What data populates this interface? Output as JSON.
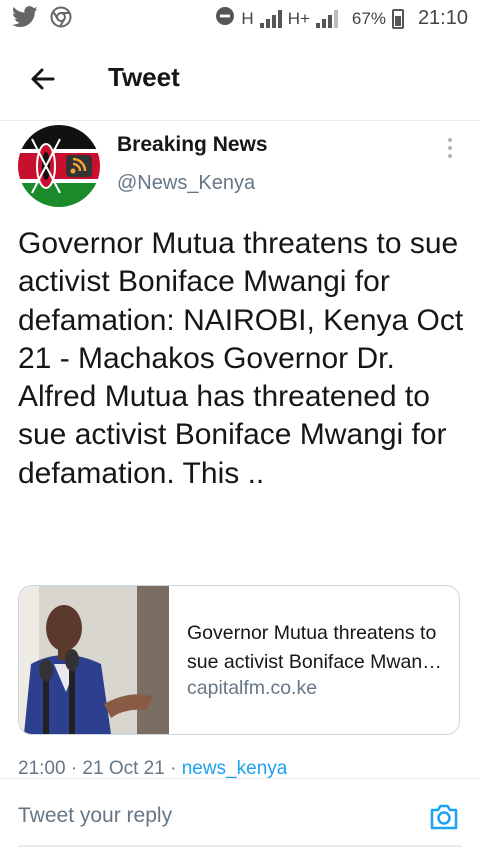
{
  "status_bar": {
    "icons": [
      "twitter-icon",
      "chrome-icon",
      "do-not-disturb-icon",
      "signal-icon",
      "battery-icon"
    ],
    "network_1": "H",
    "network_2": "H+",
    "battery": "67%",
    "time": "21:10"
  },
  "header": {
    "title": "Tweet",
    "back_icon": "arrow-left-icon"
  },
  "tweet": {
    "author_name": "Breaking News",
    "author_handle": "@News_Kenya",
    "text": "Governor Mutua threatens to sue activist Boniface Mwangi for defamation: NAIROBI, Kenya Oct 21 - Machakos Governor Dr. Alfred Mutua has threatened to sue activist Boniface Mwangi for defamation. This ..",
    "card": {
      "title": "Governor Mutua threatens to sue activist Boniface Mwangi for defamation",
      "domain": "capitalfm.co.ke"
    },
    "meta_time": "21:00 · 21 Oct 21 · ",
    "meta_source": "news_kenya"
  },
  "reply": {
    "placeholder": "Tweet your reply",
    "camera_icon": "camera-icon"
  },
  "colors": {
    "accent": "#1da1f2",
    "secondary_text": "#657786",
    "border": "#e6ecf0"
  }
}
